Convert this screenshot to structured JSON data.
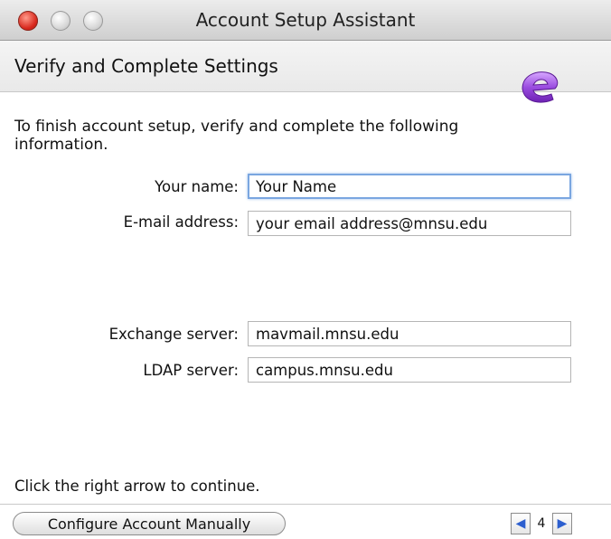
{
  "window": {
    "title": "Account Setup Assistant"
  },
  "header": {
    "title": "Verify and Complete Settings",
    "logo_icon": "entourage-logo-icon"
  },
  "intro_text": "To finish account setup, verify and complete the following information.",
  "form": {
    "name_label": "Your name:",
    "name_value": "Your Name",
    "email_label": "E-mail address:",
    "email_value": "your email address@mnsu.edu",
    "exchange_label": "Exchange server:",
    "exchange_value": "mavmail.mnsu.edu",
    "ldap_label": "LDAP server:",
    "ldap_value": "campus.mnsu.edu"
  },
  "footer": {
    "hint": "Click the right arrow to continue.",
    "manual_button": "Configure Account Manually",
    "page_number": "4"
  },
  "colors": {
    "accent": "#2d5fcf",
    "logo_purple": "#8b3fd1"
  }
}
